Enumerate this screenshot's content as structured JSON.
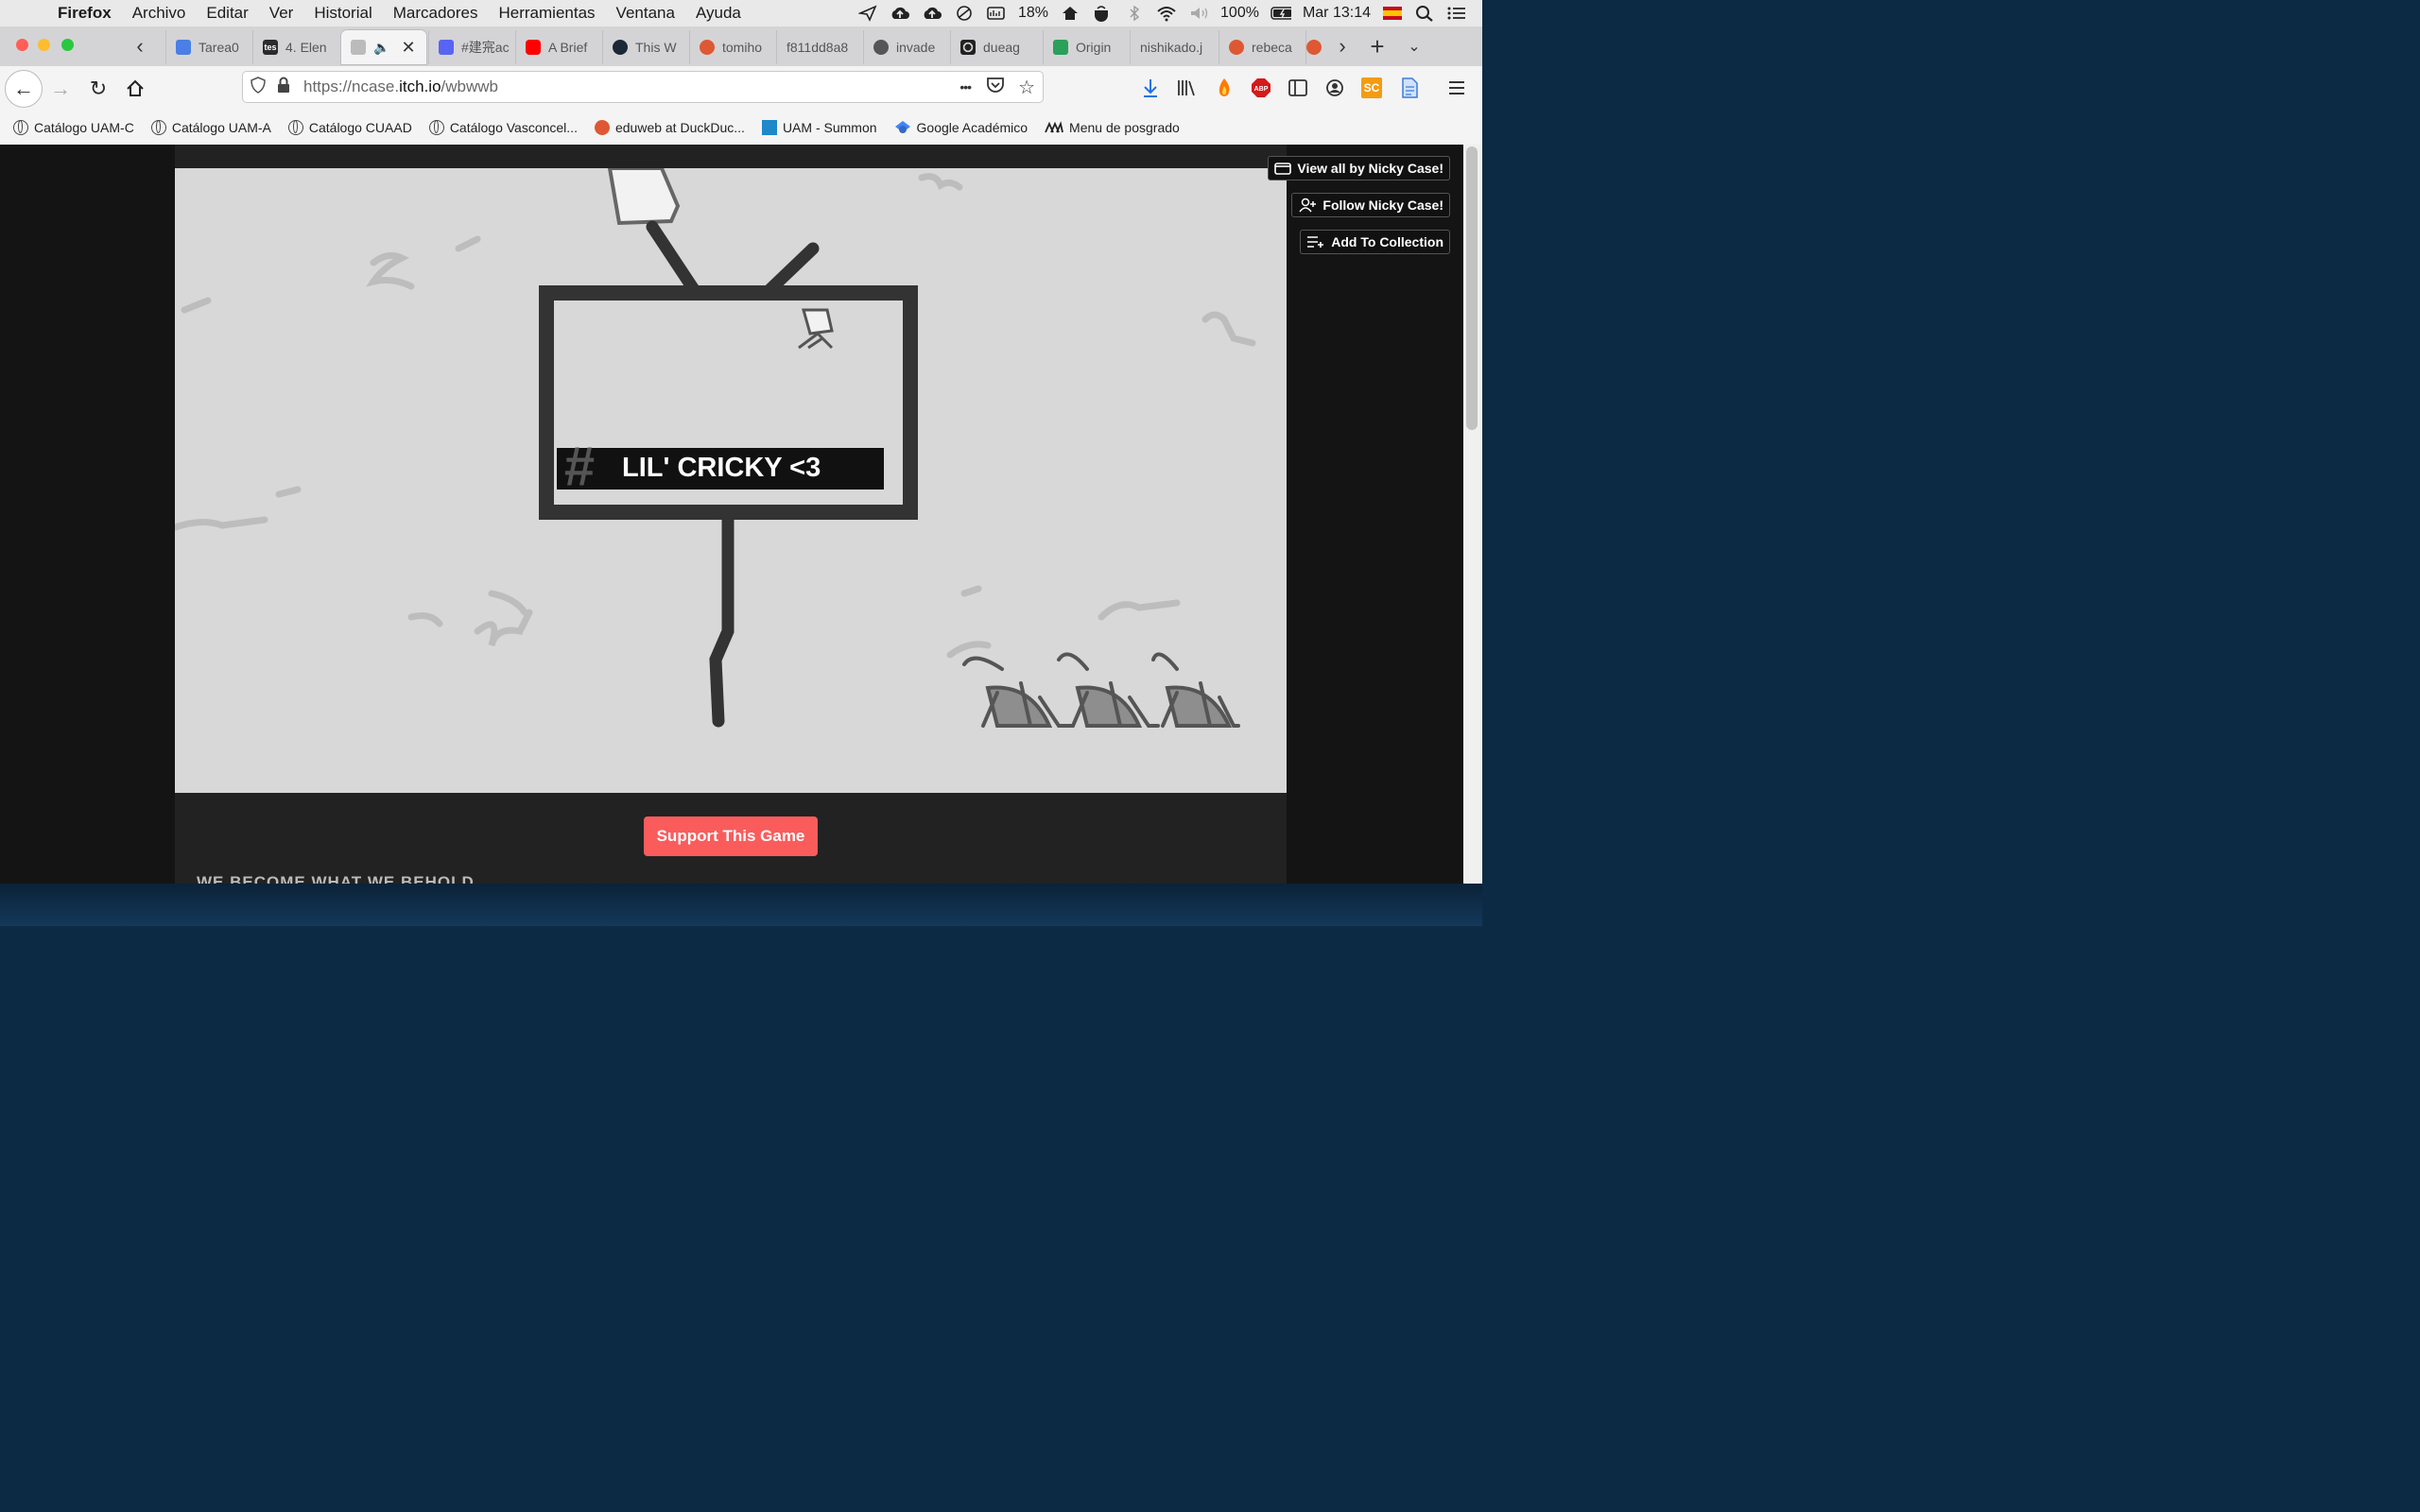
{
  "menubar": {
    "apple": "",
    "app_name": "Firefox",
    "items": [
      "Archivo",
      "Editar",
      "Ver",
      "Historial",
      "Marcadores",
      "Herramientas",
      "Ventana",
      "Ayuda"
    ],
    "cpu": "18%",
    "battery": "100%",
    "clock": "Mar 13:14"
  },
  "tabs": [
    {
      "title": "Tarea0",
      "favicon": "docs-icon",
      "color": "#4a7fe5"
    },
    {
      "title": "4. Elen",
      "favicon": "tes-icon",
      "color": "#2b2b2b"
    },
    {
      "title": "",
      "favicon": "game-icon",
      "color": "#888888"
    },
    {
      "title": "#建宺ac",
      "favicon": "discord-icon",
      "color": "#5865f2"
    },
    {
      "title": "A Brief",
      "favicon": "youtube-icon",
      "color": "#ff0000"
    },
    {
      "title": "This W",
      "favicon": "steam-icon",
      "color": "#1b2838"
    },
    {
      "title": "tomiho",
      "favicon": "duckduckgo-icon",
      "color": "#de5833"
    },
    {
      "title": "f811dd8a8",
      "favicon": "none",
      "color": "#d4d4d6"
    },
    {
      "title": "invade",
      "favicon": "github-icon",
      "color": "#333333"
    },
    {
      "title": "dueag",
      "favicon": "dots-icon",
      "color": "#222222"
    },
    {
      "title": "Origin",
      "favicon": "origin-icon",
      "color": "#2aa05a"
    },
    {
      "title": "nishikado.j",
      "favicon": "none",
      "color": "#d4d4d6"
    },
    {
      "title": "rebeca",
      "favicon": "duckduckgo-icon",
      "color": "#de5833"
    }
  ],
  "navbar": {
    "url_prefix": "https://ncase.",
    "url_domain": "itch.io",
    "url_path": "/wbwwb",
    "more": "•••"
  },
  "bookmarks": [
    {
      "label": "Catálogo UAM-C",
      "icon": "globe-icon"
    },
    {
      "label": "Catálogo UAM-A",
      "icon": "globe-icon"
    },
    {
      "label": "Catálogo CUAAD",
      "icon": "globe-icon"
    },
    {
      "label": "Catálogo Vasconcel...",
      "icon": "globe-icon"
    },
    {
      "label": "eduweb at DuckDuc...",
      "icon": "duckduckgo-icon"
    },
    {
      "label": "UAM - Summon",
      "icon": "summon-icon"
    },
    {
      "label": "Google Académico",
      "icon": "scholar-icon"
    },
    {
      "label": "Menu de posgrado",
      "icon": "uam-icon"
    }
  ],
  "itch": {
    "view_all": "View all by Nicky Case!",
    "follow": "Follow Nicky Case!",
    "add_collection": "Add To Collection",
    "support": "Support This Game",
    "caption": "WE BECOME WHAT WE BEHOLD"
  },
  "game": {
    "hashtag": "#",
    "headline": "LIL' CRICKY <3"
  },
  "colors": {
    "support_button": "#fa5c5c",
    "game_bg": "#d8d8d8",
    "page_bg": "#141414"
  }
}
